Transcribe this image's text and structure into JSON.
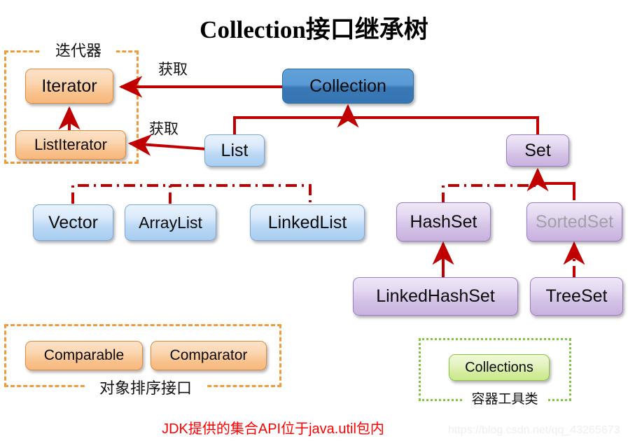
{
  "title": "Collection接口继承树",
  "footnote": "JDK提供的集合API位于java.util包内",
  "watermark": "https://blog.csdn.net/qq_43265673",
  "groups": {
    "iterator": {
      "caption": "迭代器"
    },
    "sorting": {
      "caption": "对象排序接口"
    },
    "utility": {
      "caption": "容器工具类"
    }
  },
  "edge_labels": {
    "collection_to_iterator": "获取",
    "list_to_listiterator": "获取"
  },
  "nodes": {
    "iterator": "Iterator",
    "list_iterator": "ListIterator",
    "collection": "Collection",
    "list": "List",
    "set": "Set",
    "vector": "Vector",
    "array_list": "ArrayList",
    "linked_list": "LinkedList",
    "hash_set": "HashSet",
    "sorted_set": "SortedSet",
    "linked_hash_set": "LinkedHashSet",
    "tree_set": "TreeSet",
    "comparable": "Comparable",
    "comparator": "Comparator",
    "collections": "Collections"
  },
  "colors": {
    "edge": "#c00000",
    "interface_blue": "#5b9bd5",
    "class_blue": "#bcd9f5",
    "set_purple": "#d4c2e6",
    "iterator_orange": "#f9c28d",
    "utility_green": "#d3ec9c",
    "group_orange": "#ef9b3c",
    "group_green": "#7ec63f",
    "footnote_red": "#ff0000",
    "muted_text": "#a39fa6"
  }
}
